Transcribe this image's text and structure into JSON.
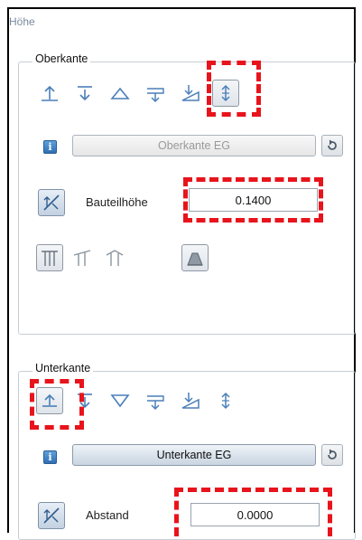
{
  "window": {
    "title": "Höhe"
  },
  "oberkante": {
    "legend": "Oberkante",
    "selected_tool": "upper-lower-arrow",
    "reference_button_label": "Oberkante EG",
    "height_label": "Bauteilhöhe",
    "height_value": "0.1400"
  },
  "unterkante": {
    "legend": "Unterkante",
    "selected_tool": "arrow-up",
    "reference_button_label": "Unterkante EG",
    "distance_label": "Abstand",
    "distance_value": "0.0000"
  },
  "colors": {
    "highlight": "#e8141c",
    "frame": "#000000",
    "title": "#7a8a9e"
  }
}
